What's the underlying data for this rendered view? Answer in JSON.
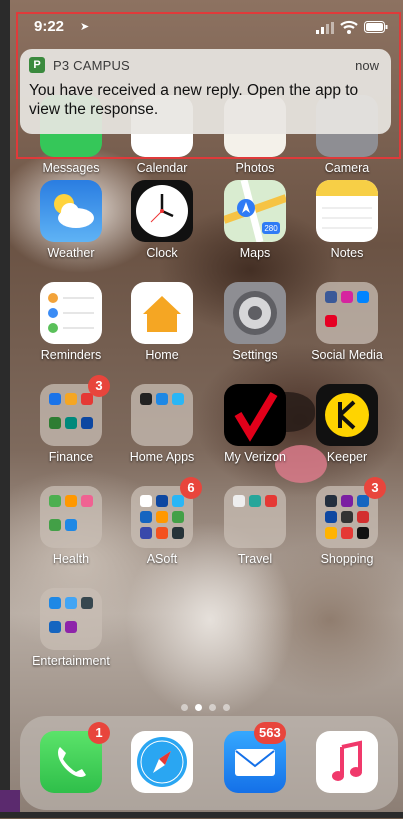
{
  "status_bar": {
    "time": "9:22",
    "location_icon": "location-arrow-icon",
    "icons": [
      "cellular-signal-icon",
      "wifi-icon",
      "battery-icon"
    ]
  },
  "notification": {
    "app_icon_letter": "P",
    "app_name": "P3 CAMPUS",
    "time": "now",
    "message": "You have received a new reply.  Open the app to view the response."
  },
  "partially_hidden_row": {
    "labels": [
      "Messages",
      "Calendar",
      "Photos",
      "Camera"
    ]
  },
  "apps": [
    {
      "label": "Weather",
      "icon": "weather-icon"
    },
    {
      "label": "Clock",
      "icon": "clock-icon"
    },
    {
      "label": "Maps",
      "icon": "maps-icon",
      "detail": "280"
    },
    {
      "label": "Notes",
      "icon": "notes-icon"
    },
    {
      "label": "Reminders",
      "icon": "reminders-icon"
    },
    {
      "label": "Home",
      "icon": "home-icon"
    },
    {
      "label": "Settings",
      "icon": "settings-gear-icon"
    },
    {
      "label": "Social Media",
      "icon": "folder-icon"
    },
    {
      "label": "Finance",
      "icon": "folder-icon",
      "badge": "3"
    },
    {
      "label": "Home Apps",
      "icon": "folder-icon"
    },
    {
      "label": "My Verizon",
      "icon": "verizon-check-icon"
    },
    {
      "label": "Keeper",
      "icon": "keeper-icon"
    },
    {
      "label": "Health",
      "icon": "folder-icon"
    },
    {
      "label": "ASoft",
      "icon": "folder-icon",
      "badge": "6"
    },
    {
      "label": "Travel",
      "icon": "folder-icon"
    },
    {
      "label": "Shopping",
      "icon": "folder-icon",
      "badge": "3"
    },
    {
      "label": "Entertainment",
      "icon": "folder-icon"
    }
  ],
  "dock": [
    {
      "name": "Phone",
      "icon": "phone-icon",
      "badge": "1"
    },
    {
      "name": "Safari",
      "icon": "safari-compass-icon"
    },
    {
      "name": "Mail",
      "icon": "mail-envelope-icon",
      "badge": "563"
    },
    {
      "name": "Music",
      "icon": "music-note-icon"
    }
  ],
  "page_indicator": {
    "pages": 4,
    "current": 2
  },
  "colors": {
    "highlight": "#e03a3a",
    "badge": "#e8453c",
    "p3_green": "#3b8a3e"
  }
}
